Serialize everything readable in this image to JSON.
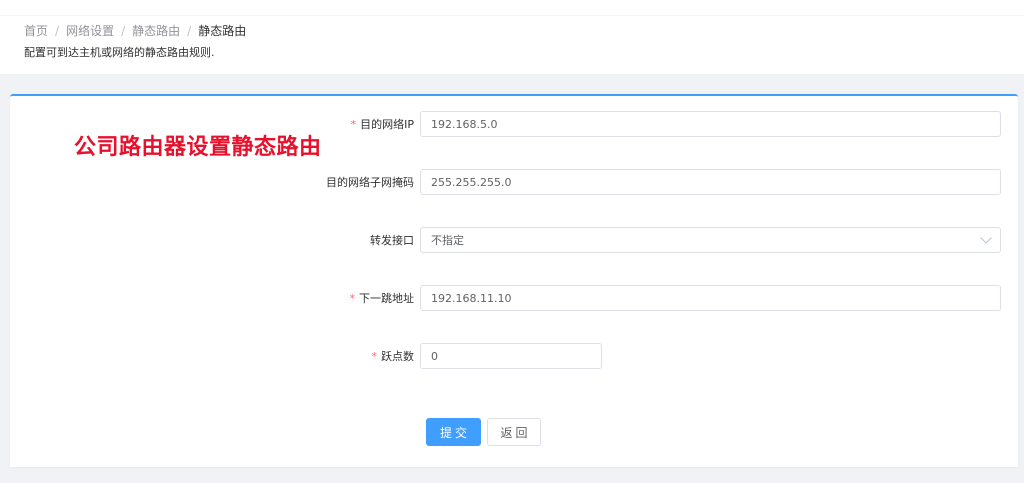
{
  "breadcrumb": {
    "items": [
      "首页",
      "网络设置",
      "静态路由",
      "静态路由"
    ],
    "separator": "/"
  },
  "page": {
    "description": "配置可到达主机或网络的静态路由规则."
  },
  "overlay": {
    "note": "公司路由器设置静态路由"
  },
  "form": {
    "dest_ip": {
      "label": "目的网络IP",
      "required": "*",
      "value": "192.168.5.0"
    },
    "dest_mask": {
      "label": "目的网络子网掩码",
      "value": "255.255.255.0"
    },
    "interface": {
      "label": "转发接口",
      "value": "不指定"
    },
    "next_hop": {
      "label": "下一跳地址",
      "required": "*",
      "value": "192.168.11.10"
    },
    "hops": {
      "label": "跃点数",
      "required": "*",
      "value": "0"
    }
  },
  "actions": {
    "submit_label": "提交",
    "back_label": "返回"
  },
  "colors": {
    "accent": "#409eff",
    "required": "#f56c6c",
    "overlay_text": "#e8112d"
  }
}
